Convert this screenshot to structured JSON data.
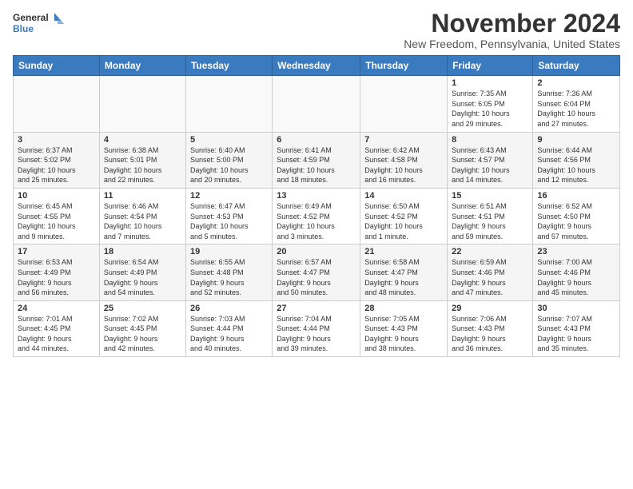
{
  "header": {
    "logo_line1": "General",
    "logo_line2": "Blue",
    "title": "November 2024",
    "location": "New Freedom, Pennsylvania, United States"
  },
  "days_of_week": [
    "Sunday",
    "Monday",
    "Tuesday",
    "Wednesday",
    "Thursday",
    "Friday",
    "Saturday"
  ],
  "weeks": [
    [
      {
        "day": "",
        "info": ""
      },
      {
        "day": "",
        "info": ""
      },
      {
        "day": "",
        "info": ""
      },
      {
        "day": "",
        "info": ""
      },
      {
        "day": "",
        "info": ""
      },
      {
        "day": "1",
        "info": "Sunrise: 7:35 AM\nSunset: 6:05 PM\nDaylight: 10 hours\nand 29 minutes."
      },
      {
        "day": "2",
        "info": "Sunrise: 7:36 AM\nSunset: 6:04 PM\nDaylight: 10 hours\nand 27 minutes."
      }
    ],
    [
      {
        "day": "3",
        "info": "Sunrise: 6:37 AM\nSunset: 5:02 PM\nDaylight: 10 hours\nand 25 minutes."
      },
      {
        "day": "4",
        "info": "Sunrise: 6:38 AM\nSunset: 5:01 PM\nDaylight: 10 hours\nand 22 minutes."
      },
      {
        "day": "5",
        "info": "Sunrise: 6:40 AM\nSunset: 5:00 PM\nDaylight: 10 hours\nand 20 minutes."
      },
      {
        "day": "6",
        "info": "Sunrise: 6:41 AM\nSunset: 4:59 PM\nDaylight: 10 hours\nand 18 minutes."
      },
      {
        "day": "7",
        "info": "Sunrise: 6:42 AM\nSunset: 4:58 PM\nDaylight: 10 hours\nand 16 minutes."
      },
      {
        "day": "8",
        "info": "Sunrise: 6:43 AM\nSunset: 4:57 PM\nDaylight: 10 hours\nand 14 minutes."
      },
      {
        "day": "9",
        "info": "Sunrise: 6:44 AM\nSunset: 4:56 PM\nDaylight: 10 hours\nand 12 minutes."
      }
    ],
    [
      {
        "day": "10",
        "info": "Sunrise: 6:45 AM\nSunset: 4:55 PM\nDaylight: 10 hours\nand 9 minutes."
      },
      {
        "day": "11",
        "info": "Sunrise: 6:46 AM\nSunset: 4:54 PM\nDaylight: 10 hours\nand 7 minutes."
      },
      {
        "day": "12",
        "info": "Sunrise: 6:47 AM\nSunset: 4:53 PM\nDaylight: 10 hours\nand 5 minutes."
      },
      {
        "day": "13",
        "info": "Sunrise: 6:49 AM\nSunset: 4:52 PM\nDaylight: 10 hours\nand 3 minutes."
      },
      {
        "day": "14",
        "info": "Sunrise: 6:50 AM\nSunset: 4:52 PM\nDaylight: 10 hours\nand 1 minute."
      },
      {
        "day": "15",
        "info": "Sunrise: 6:51 AM\nSunset: 4:51 PM\nDaylight: 9 hours\nand 59 minutes."
      },
      {
        "day": "16",
        "info": "Sunrise: 6:52 AM\nSunset: 4:50 PM\nDaylight: 9 hours\nand 57 minutes."
      }
    ],
    [
      {
        "day": "17",
        "info": "Sunrise: 6:53 AM\nSunset: 4:49 PM\nDaylight: 9 hours\nand 56 minutes."
      },
      {
        "day": "18",
        "info": "Sunrise: 6:54 AM\nSunset: 4:49 PM\nDaylight: 9 hours\nand 54 minutes."
      },
      {
        "day": "19",
        "info": "Sunrise: 6:55 AM\nSunset: 4:48 PM\nDaylight: 9 hours\nand 52 minutes."
      },
      {
        "day": "20",
        "info": "Sunrise: 6:57 AM\nSunset: 4:47 PM\nDaylight: 9 hours\nand 50 minutes."
      },
      {
        "day": "21",
        "info": "Sunrise: 6:58 AM\nSunset: 4:47 PM\nDaylight: 9 hours\nand 48 minutes."
      },
      {
        "day": "22",
        "info": "Sunrise: 6:59 AM\nSunset: 4:46 PM\nDaylight: 9 hours\nand 47 minutes."
      },
      {
        "day": "23",
        "info": "Sunrise: 7:00 AM\nSunset: 4:46 PM\nDaylight: 9 hours\nand 45 minutes."
      }
    ],
    [
      {
        "day": "24",
        "info": "Sunrise: 7:01 AM\nSunset: 4:45 PM\nDaylight: 9 hours\nand 44 minutes."
      },
      {
        "day": "25",
        "info": "Sunrise: 7:02 AM\nSunset: 4:45 PM\nDaylight: 9 hours\nand 42 minutes."
      },
      {
        "day": "26",
        "info": "Sunrise: 7:03 AM\nSunset: 4:44 PM\nDaylight: 9 hours\nand 40 minutes."
      },
      {
        "day": "27",
        "info": "Sunrise: 7:04 AM\nSunset: 4:44 PM\nDaylight: 9 hours\nand 39 minutes."
      },
      {
        "day": "28",
        "info": "Sunrise: 7:05 AM\nSunset: 4:43 PM\nDaylight: 9 hours\nand 38 minutes."
      },
      {
        "day": "29",
        "info": "Sunrise: 7:06 AM\nSunset: 4:43 PM\nDaylight: 9 hours\nand 36 minutes."
      },
      {
        "day": "30",
        "info": "Sunrise: 7:07 AM\nSunset: 4:43 PM\nDaylight: 9 hours\nand 35 minutes."
      }
    ]
  ]
}
